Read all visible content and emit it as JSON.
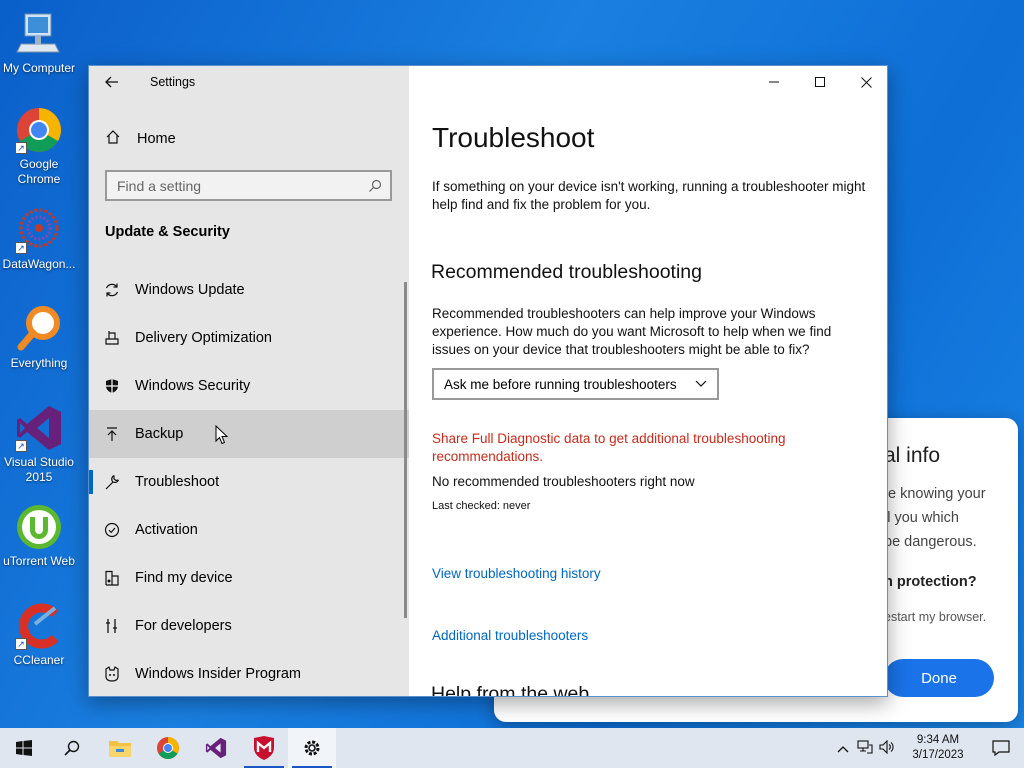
{
  "desktop": {
    "icons": [
      {
        "label": "My Computer"
      },
      {
        "label": "Google Chrome"
      },
      {
        "label": "DataWagon..."
      },
      {
        "label": "Everything"
      },
      {
        "label": "Visual Studio 2015"
      },
      {
        "label": "uTorrent Web"
      },
      {
        "label": "CCleaner"
      }
    ]
  },
  "popup": {
    "title_partial": "al info",
    "lines": [
      "te knowing your",
      "ll you which",
      "be dangerous."
    ],
    "bold_line": "n protection?",
    "small_line": "estart my browser.",
    "done_label": "Done"
  },
  "window": {
    "title": "Settings",
    "back_icon": "back-arrow-icon",
    "controls": {
      "minimize": "—",
      "maximize": "☐",
      "close": "✕"
    }
  },
  "sidebar": {
    "home_label": "Home",
    "search_placeholder": "Find a setting",
    "section_title": "Update & Security",
    "items": [
      {
        "label": "Windows Update",
        "icon": "sync-icon"
      },
      {
        "label": "Delivery Optimization",
        "icon": "delivery-icon"
      },
      {
        "label": "Windows Security",
        "icon": "shield-icon"
      },
      {
        "label": "Backup",
        "icon": "backup-icon",
        "state": "hover"
      },
      {
        "label": "Troubleshoot",
        "icon": "wrench-icon",
        "state": "selected"
      },
      {
        "label": "Activation",
        "icon": "check-circle-icon"
      },
      {
        "label": "Find my device",
        "icon": "find-device-icon"
      },
      {
        "label": "For developers",
        "icon": "developer-icon"
      },
      {
        "label": "Windows Insider Program",
        "icon": "insider-icon"
      }
    ]
  },
  "content": {
    "title": "Troubleshoot",
    "intro": "If something on your device isn't working, running a troubleshooter might help find and fix the problem for you.",
    "recommended_heading": "Recommended troubleshooting",
    "recommended_text": "Recommended troubleshooters can help improve your Windows experience. How much do you want Microsoft to help when we find issues on your device that troubleshooters might be able to fix?",
    "dropdown_value": "Ask me before running troubleshooters",
    "diagnostic_link": "Share Full Diagnostic data to get additional troubleshooting recommendations.",
    "no_recommended": "No recommended troubleshooters right now",
    "last_checked": "Last checked: never",
    "history_link": "View troubleshooting history",
    "additional_link": "Additional troubleshooters",
    "help_heading": "Help from the web"
  },
  "taskbar": {
    "clock_time": "9:34 AM",
    "clock_date": "3/17/2023",
    "apps": [
      "start-icon",
      "search-icon",
      "file-explorer-icon",
      "chrome-icon",
      "visual-studio-icon",
      "mcafee-icon",
      "settings-icon"
    ]
  },
  "colors": {
    "accent": "#0067c0",
    "link_red": "#c42b1c",
    "desktop_blue": "#1a7fe0",
    "done_blue": "#1a73e8"
  }
}
